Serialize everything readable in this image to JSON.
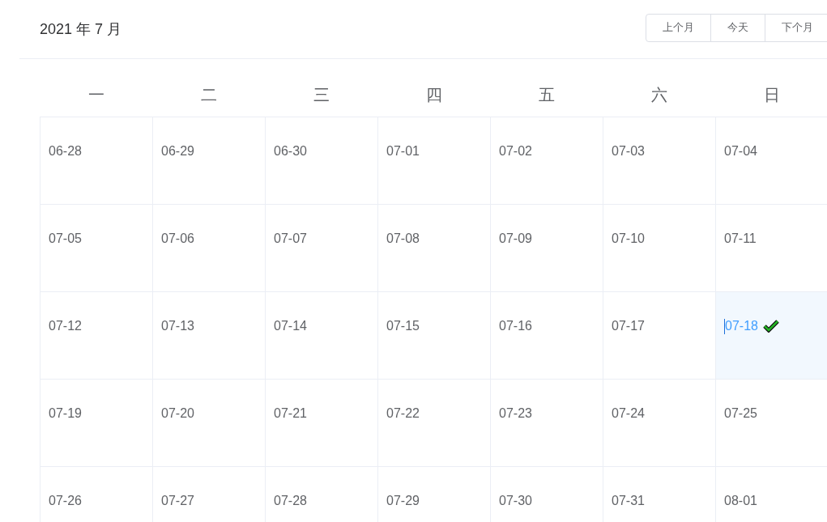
{
  "title": "2021 年 7 月",
  "buttons": [
    "上个月",
    "今天",
    "下个月"
  ],
  "weekdays": [
    "一",
    "二",
    "三",
    "四",
    "五",
    "六",
    "日"
  ],
  "weeks": [
    [
      {
        "date": "06-28",
        "selected": false
      },
      {
        "date": "06-29",
        "selected": false
      },
      {
        "date": "06-30",
        "selected": false
      },
      {
        "date": "07-01",
        "selected": false
      },
      {
        "date": "07-02",
        "selected": false
      },
      {
        "date": "07-03",
        "selected": false
      },
      {
        "date": "07-04",
        "selected": false
      }
    ],
    [
      {
        "date": "07-05",
        "selected": false
      },
      {
        "date": "07-06",
        "selected": false
      },
      {
        "date": "07-07",
        "selected": false
      },
      {
        "date": "07-08",
        "selected": false
      },
      {
        "date": "07-09",
        "selected": false
      },
      {
        "date": "07-10",
        "selected": false
      },
      {
        "date": "07-11",
        "selected": false
      }
    ],
    [
      {
        "date": "07-12",
        "selected": false
      },
      {
        "date": "07-13",
        "selected": false
      },
      {
        "date": "07-14",
        "selected": false
      },
      {
        "date": "07-15",
        "selected": false
      },
      {
        "date": "07-16",
        "selected": false
      },
      {
        "date": "07-17",
        "selected": false
      },
      {
        "date": "07-18",
        "selected": true
      }
    ],
    [
      {
        "date": "07-19",
        "selected": false
      },
      {
        "date": "07-20",
        "selected": false
      },
      {
        "date": "07-21",
        "selected": false
      },
      {
        "date": "07-22",
        "selected": false
      },
      {
        "date": "07-23",
        "selected": false
      },
      {
        "date": "07-24",
        "selected": false
      },
      {
        "date": "07-25",
        "selected": false
      }
    ],
    [
      {
        "date": "07-26",
        "selected": false
      },
      {
        "date": "07-27",
        "selected": false
      },
      {
        "date": "07-28",
        "selected": false
      },
      {
        "date": "07-29",
        "selected": false
      },
      {
        "date": "07-30",
        "selected": false
      },
      {
        "date": "07-31",
        "selected": false
      },
      {
        "date": "08-01",
        "selected": false
      }
    ]
  ]
}
